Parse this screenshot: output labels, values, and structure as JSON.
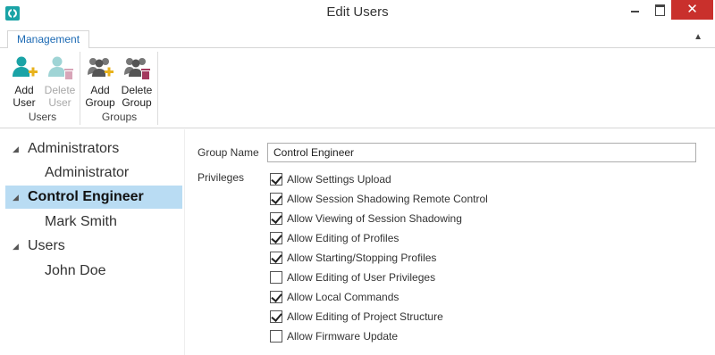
{
  "window": {
    "title": "Edit Users",
    "close_glyph": "✕",
    "controls": [
      "minimize-icon",
      "maximize-icon",
      "close-icon"
    ]
  },
  "ribbon": {
    "tab": "Management",
    "groups": [
      {
        "label": "Users",
        "buttons": [
          {
            "line1": "Add",
            "line2": "User",
            "icon": "add-user-icon",
            "enabled": true
          },
          {
            "line1": "Delete",
            "line2": "User",
            "icon": "delete-user-icon",
            "enabled": false
          }
        ]
      },
      {
        "label": "Groups",
        "buttons": [
          {
            "line1": "Add",
            "line2": "Group",
            "icon": "add-group-icon",
            "enabled": true
          },
          {
            "line1": "Delete",
            "line2": "Group",
            "icon": "delete-group-icon",
            "enabled": true
          }
        ]
      }
    ]
  },
  "tree": {
    "items": [
      {
        "label": "Administrators",
        "level": 0,
        "expanded": true,
        "selected": false
      },
      {
        "label": "Administrator",
        "level": 1,
        "selected": false
      },
      {
        "label": "Control Engineer",
        "level": 0,
        "expanded": true,
        "selected": true
      },
      {
        "label": "Mark Smith",
        "level": 1,
        "selected": false
      },
      {
        "label": "Users",
        "level": 0,
        "expanded": true,
        "selected": false
      },
      {
        "label": "John Doe",
        "level": 1,
        "selected": false
      }
    ]
  },
  "details": {
    "group_name_label": "Group Name",
    "group_name_value": "Control Engineer",
    "privileges_label": "Privileges",
    "privileges": [
      {
        "label": "Allow Settings Upload",
        "checked": true
      },
      {
        "label": "Allow Session Shadowing Remote Control",
        "checked": true
      },
      {
        "label": "Allow Viewing of Session Shadowing",
        "checked": true
      },
      {
        "label": "Allow Editing of Profiles",
        "checked": true
      },
      {
        "label": "Allow Starting/Stopping Profiles",
        "checked": true
      },
      {
        "label": "Allow Editing of User Privileges",
        "checked": false
      },
      {
        "label": "Allow Local Commands",
        "checked": true
      },
      {
        "label": "Allow Editing of Project Structure",
        "checked": true
      },
      {
        "label": "Allow Firmware Update",
        "checked": false
      }
    ]
  },
  "colors": {
    "accent_teal": "#1aa3a6",
    "add_plus": "#e8b21c",
    "delete_red": "#a33a5e",
    "selection": "#b9dcf3",
    "close_button": "#c9302c",
    "tab_text": "#1c6ab4"
  }
}
